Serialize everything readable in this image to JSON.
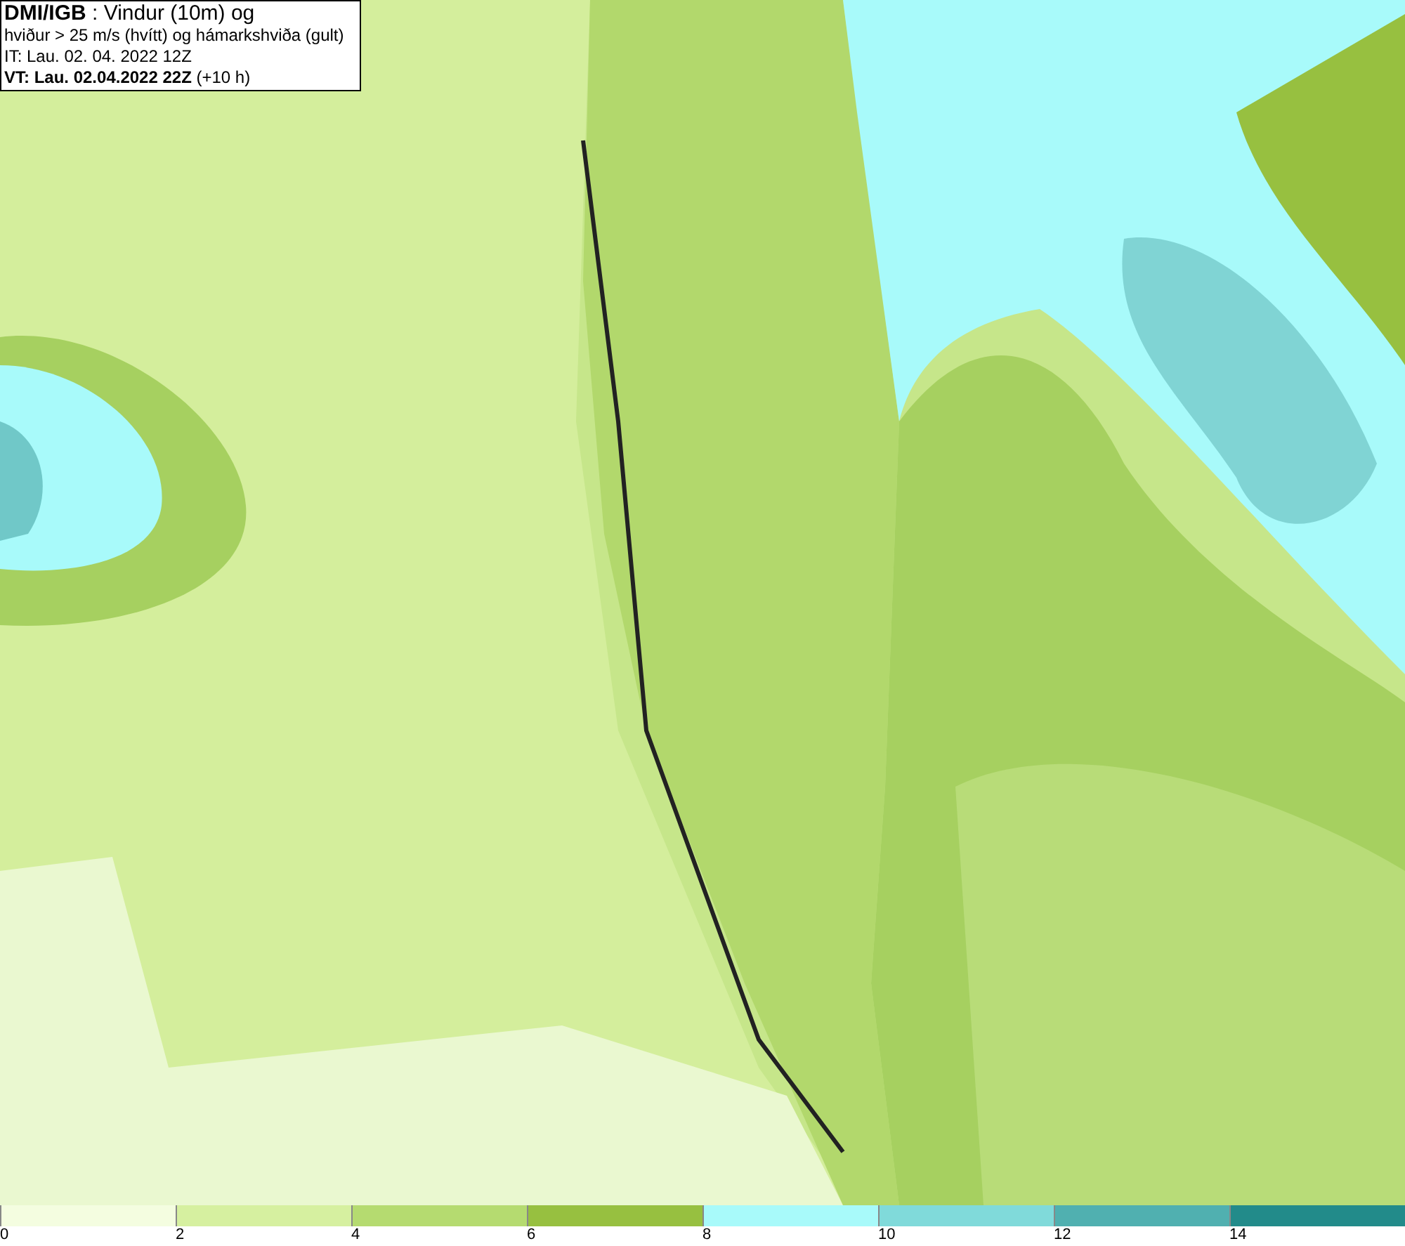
{
  "header": {
    "lines": [
      "**DMI/IGB** : Vindur (10m) og",
      "hviður > 25 m/s (hvítt) og hámarkshviða (gult)",
      "IT: Lau. 02. 04. 2022 12Z",
      "**VT: Lau. 02.04.2022 22Z** (+10 h)"
    ]
  },
  "legend": [
    {
      "label": "0",
      "color": "#f4fde0"
    },
    {
      "label": "2",
      "color": "#d6f0a0"
    },
    {
      "label": "4",
      "color": "#b5db70"
    },
    {
      "label": "6",
      "color": "#97c040"
    },
    {
      "label": "8",
      "color": "#a8fafa"
    },
    {
      "label": "10",
      "color": "#80dada"
    },
    {
      "label": "12",
      "color": "#50b0b0"
    },
    {
      "label": "14",
      "color": "#228b8a"
    }
  ]
}
